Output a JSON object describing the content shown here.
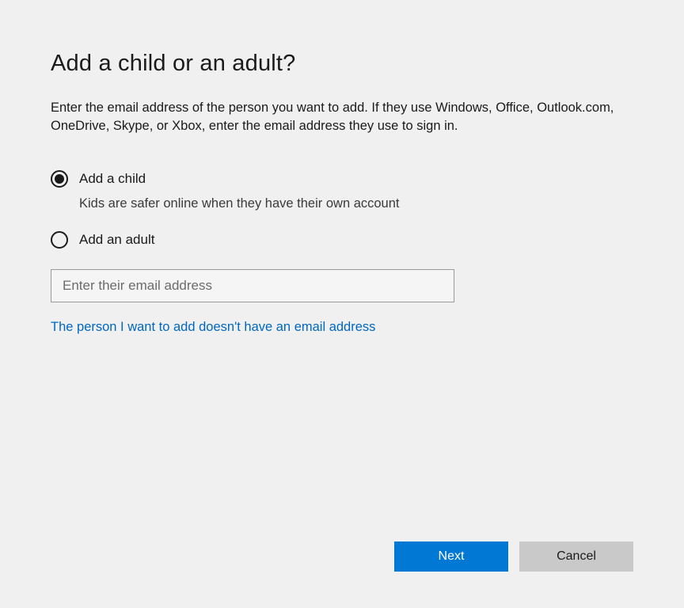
{
  "title": "Add a child or an adult?",
  "description": "Enter the email address of the person you want to add. If they use Windows, Office, Outlook.com, OneDrive, Skype, or Xbox, enter the email address they use to sign in.",
  "options": {
    "child": {
      "label": "Add a child",
      "sublabel": "Kids are safer online when they have their own account",
      "selected": true
    },
    "adult": {
      "label": "Add an adult",
      "selected": false
    }
  },
  "email": {
    "value": "",
    "placeholder": "Enter their email address"
  },
  "link_no_email": "The person I want to add doesn't have an email address",
  "buttons": {
    "next": "Next",
    "cancel": "Cancel"
  }
}
